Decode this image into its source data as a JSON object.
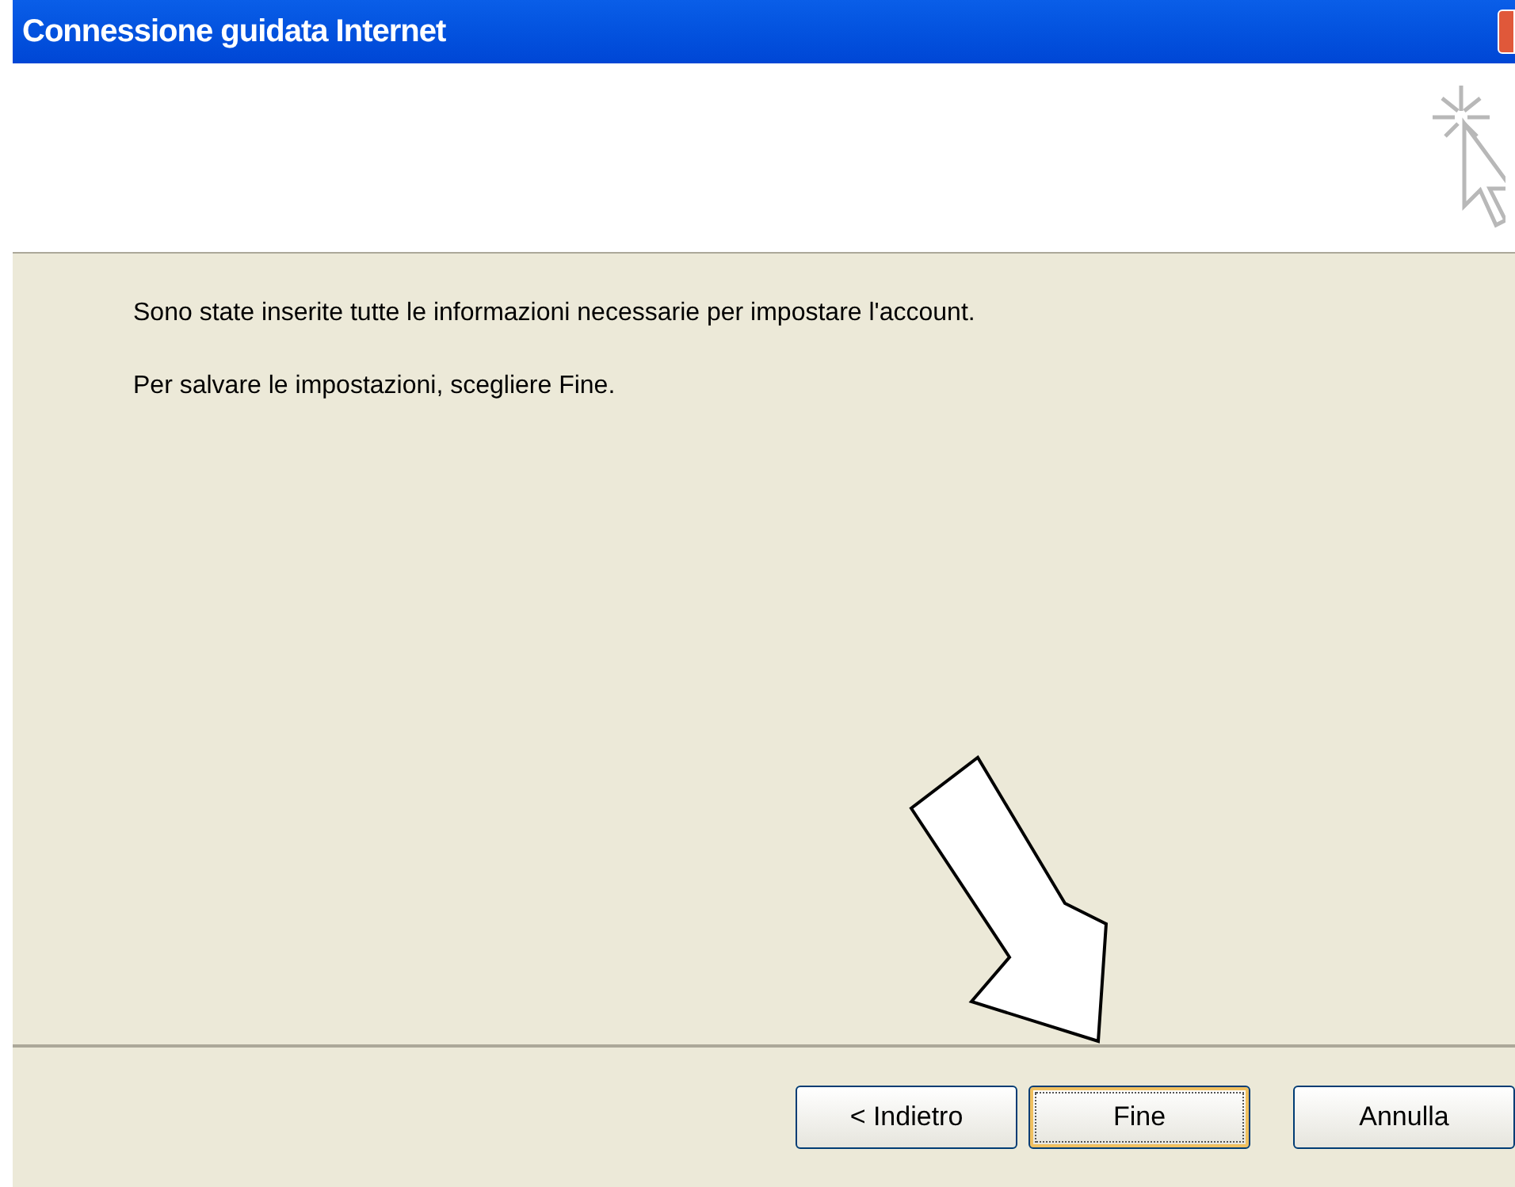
{
  "window": {
    "title": "Connessione guidata Internet"
  },
  "messages": [
    "Sono state inserite tutte le informazioni necessarie per impostare l'account.",
    "Per salvare le impostazioni, scegliere Fine."
  ],
  "buttons": [
    {
      "label": "< Indietro",
      "focused": false
    },
    {
      "label": "Fine",
      "focused": true
    },
    {
      "label": "Annulla",
      "focused": false
    }
  ]
}
